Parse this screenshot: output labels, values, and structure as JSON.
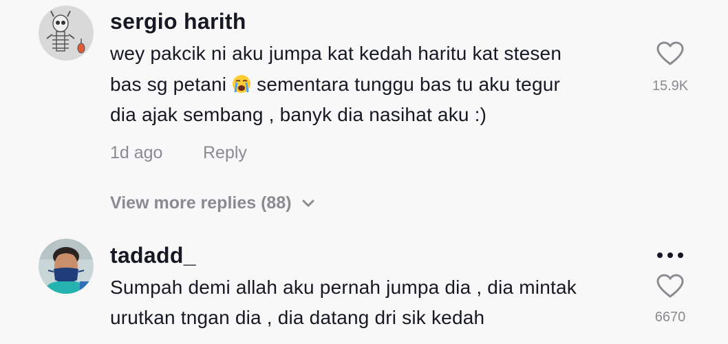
{
  "comments": [
    {
      "username": "sergio harith",
      "lines": [
        "wey pakcik ni aku jumpa kat kedah haritu kat stesen",
        "bas sg petani",
        "sementara tunggu bas tu aku tegur",
        "dia ajak sembang , banyk dia nasihat aku :)"
      ],
      "time": "1d ago",
      "reply_label": "Reply",
      "like_count": "15.9K",
      "avatar_icon": "skeleton-avatar",
      "emoji_icon": "loudly-crying-face-icon"
    },
    {
      "username": "tadadd_",
      "lines": [
        "Sumpah demi allah aku pernah jumpa dia , dia mintak",
        "urutkan tngan dia , dia datang dri sik kedah"
      ],
      "like_count": "6670",
      "avatar_icon": "person-with-mask-avatar",
      "more_icon": "more-options-icon"
    }
  ],
  "view_more_replies": "View more replies (88)",
  "colors": {
    "background": "#f8f8f8",
    "primary_text": "#161823",
    "secondary_text": "#8a8b91"
  }
}
